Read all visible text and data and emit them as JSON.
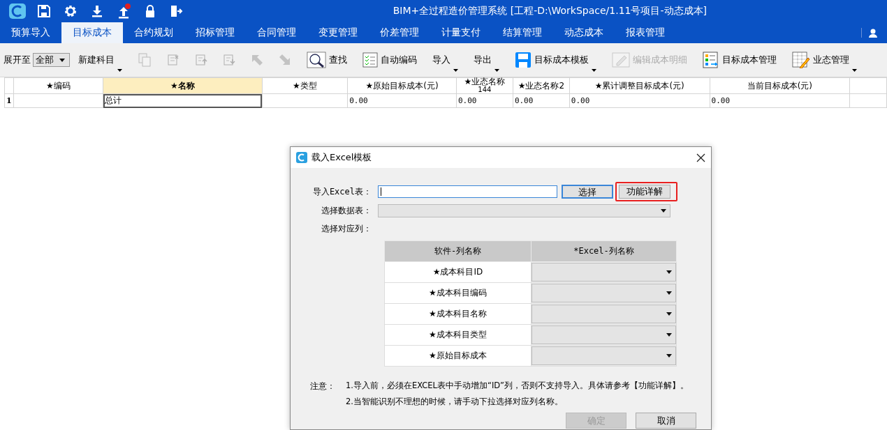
{
  "title_bar": {
    "title": "BIM+全过程造价管理系统 [工程-D:\\WorkSpace/1.11号项目-动态成本]"
  },
  "tabs": [
    {
      "label": "预算导入",
      "selected": false
    },
    {
      "label": "目标成本",
      "selected": true
    },
    {
      "label": "合约规划",
      "selected": false
    },
    {
      "label": "招标管理",
      "selected": false
    },
    {
      "label": "合同管理",
      "selected": false
    },
    {
      "label": "变更管理",
      "selected": false
    },
    {
      "label": "价差管理",
      "selected": false
    },
    {
      "label": "计量支付",
      "selected": false
    },
    {
      "label": "结算管理",
      "selected": false
    },
    {
      "label": "动态成本",
      "selected": false
    },
    {
      "label": "报表管理",
      "selected": false
    }
  ],
  "toolbar": {
    "expand_label": "展开至",
    "expand_value": "全部",
    "items": [
      {
        "label": "新建科目",
        "disabled": false,
        "menu": true
      },
      {
        "disabled": true,
        "menu": false
      },
      {
        "disabled": true,
        "menu": false
      },
      {
        "disabled": true,
        "menu": false
      },
      {
        "disabled": true,
        "menu": false
      },
      {
        "disabled": true,
        "menu": false
      },
      {
        "disabled": true,
        "menu": false
      },
      {
        "label": "查找",
        "disabled": false,
        "menu": false
      },
      {
        "label": "自动编码",
        "disabled": false,
        "menu": false
      },
      {
        "label": "导入",
        "disabled": false,
        "menu": true
      },
      {
        "label": "导出",
        "disabled": false,
        "menu": true
      },
      {
        "label": "目标成本模板",
        "disabled": false,
        "menu": true
      },
      {
        "label": "编辑成本明细",
        "disabled": true,
        "menu": false
      },
      {
        "label": "目标成本管理",
        "disabled": false,
        "menu": false
      },
      {
        "label": "业态管理",
        "disabled": false,
        "menu": true
      }
    ]
  },
  "grid": {
    "columns": [
      {
        "label": "★编码",
        "selected": false
      },
      {
        "label": "★名称",
        "selected": true
      },
      {
        "label": "★类型",
        "selected": false
      },
      {
        "label": "★原始目标成本(元)",
        "selected": false
      },
      {
        "label": "★业态名称",
        "sub": "144",
        "selected": false
      },
      {
        "label": "★业态名称2",
        "selected": false
      },
      {
        "label": "★累计调整目标成本(元)",
        "selected": false
      },
      {
        "label": "当前目标成本(元)",
        "selected": false
      }
    ],
    "rows": [
      {
        "number": "1",
        "cells": [
          "",
          "总计",
          "",
          "0.00",
          "0.00",
          "0.00",
          "0.00",
          "0.00"
        ]
      }
    ]
  },
  "dialog": {
    "title": "载入Excel模板",
    "file_label": "导入Excel表：",
    "choose_button": "选择",
    "help_button": {
      "label": "功能详解",
      "highlighted": true
    },
    "sheet_label": "选择数据表：",
    "mapping_label": "选择对应列：",
    "mapping_columns": [
      "软件-列名称",
      "*Excel-列名称"
    ],
    "mapping_rows": [
      "★成本科目ID",
      "★成本科目编码",
      "★成本科目名称",
      "★成本科目类型",
      "★原始目标成本"
    ],
    "note_label": "注意：",
    "notes": [
      "1.导入前，必须在EXCEL表中手动增加“ID”列，否则不支持导入。具体请参考【功能详解】。",
      "2.当智能识别不理想的时候，请手动下拉选择对应列名称。"
    ],
    "buttons": [
      {
        "label": "确定",
        "disabled": true
      },
      {
        "label": "取消",
        "disabled": false
      }
    ]
  }
}
